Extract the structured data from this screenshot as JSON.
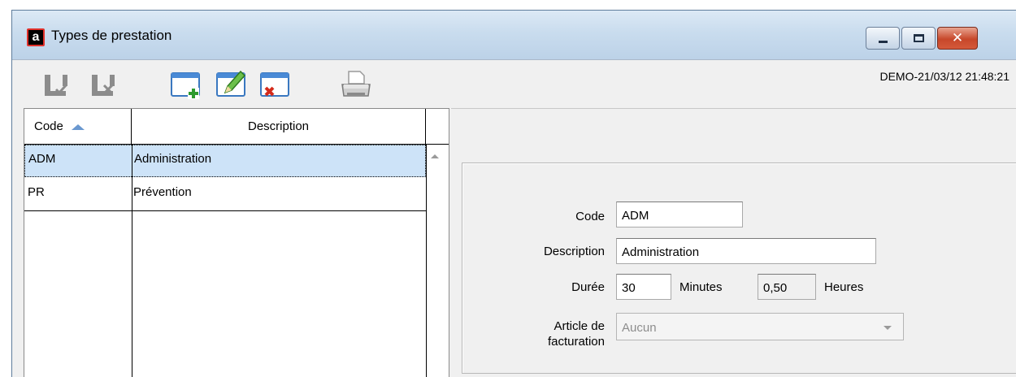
{
  "window": {
    "title": "Types de prestation",
    "app_icon_letter": "a",
    "close_glyph": "✕"
  },
  "toolbar": {
    "icons": [
      "save-check-icon",
      "save-cancel-icon",
      "new-record-icon",
      "edit-record-icon",
      "delete-record-icon",
      "printer-icon"
    ],
    "timestamp": "DEMO-21/03/12 21:48:21"
  },
  "grid": {
    "columns": [
      "Code",
      "Description"
    ],
    "sort_column": "Code",
    "rows": [
      {
        "code": "ADM",
        "description": "Administration",
        "selected": true
      },
      {
        "code": "PR",
        "description": "Prévention",
        "selected": false
      }
    ]
  },
  "form": {
    "code_label": "Code",
    "code_value": "ADM",
    "description_label": "Description",
    "description_value": "Administration",
    "duree_label": "Durée",
    "duree_value": "30",
    "minutes_label": "Minutes",
    "heures_value": "0,50",
    "heures_label": "Heures",
    "article_label_line1": "Article de",
    "article_label_line2": "facturation",
    "article_value": "Aucun"
  },
  "colors": {
    "selection": "#cde3f8",
    "titlebar": "#c9dcee",
    "close_button": "#c7472a"
  }
}
